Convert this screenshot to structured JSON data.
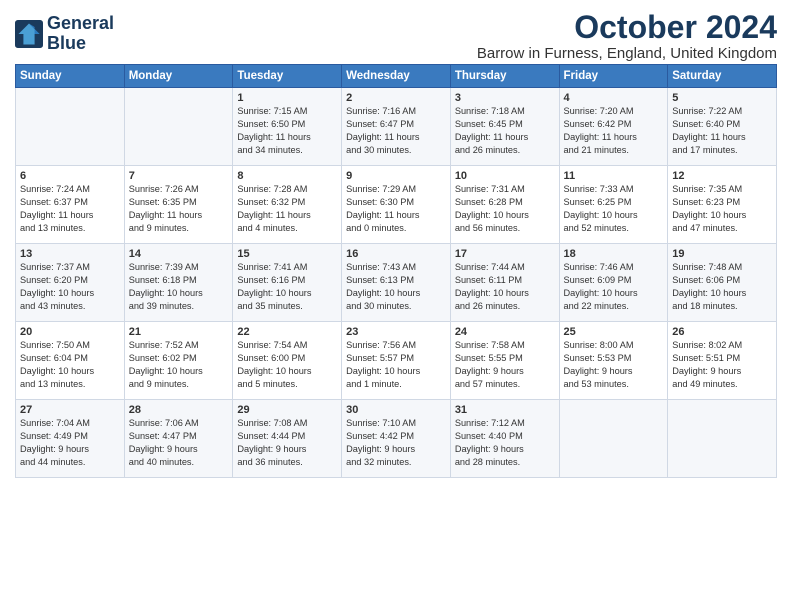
{
  "header": {
    "logo_line1": "General",
    "logo_line2": "Blue",
    "title": "October 2024",
    "location": "Barrow in Furness, England, United Kingdom"
  },
  "days_of_week": [
    "Sunday",
    "Monday",
    "Tuesday",
    "Wednesday",
    "Thursday",
    "Friday",
    "Saturday"
  ],
  "weeks": [
    [
      {
        "day": "",
        "info": ""
      },
      {
        "day": "",
        "info": ""
      },
      {
        "day": "1",
        "info": "Sunrise: 7:15 AM\nSunset: 6:50 PM\nDaylight: 11 hours\nand 34 minutes."
      },
      {
        "day": "2",
        "info": "Sunrise: 7:16 AM\nSunset: 6:47 PM\nDaylight: 11 hours\nand 30 minutes."
      },
      {
        "day": "3",
        "info": "Sunrise: 7:18 AM\nSunset: 6:45 PM\nDaylight: 11 hours\nand 26 minutes."
      },
      {
        "day": "4",
        "info": "Sunrise: 7:20 AM\nSunset: 6:42 PM\nDaylight: 11 hours\nand 21 minutes."
      },
      {
        "day": "5",
        "info": "Sunrise: 7:22 AM\nSunset: 6:40 PM\nDaylight: 11 hours\nand 17 minutes."
      }
    ],
    [
      {
        "day": "6",
        "info": "Sunrise: 7:24 AM\nSunset: 6:37 PM\nDaylight: 11 hours\nand 13 minutes."
      },
      {
        "day": "7",
        "info": "Sunrise: 7:26 AM\nSunset: 6:35 PM\nDaylight: 11 hours\nand 9 minutes."
      },
      {
        "day": "8",
        "info": "Sunrise: 7:28 AM\nSunset: 6:32 PM\nDaylight: 11 hours\nand 4 minutes."
      },
      {
        "day": "9",
        "info": "Sunrise: 7:29 AM\nSunset: 6:30 PM\nDaylight: 11 hours\nand 0 minutes."
      },
      {
        "day": "10",
        "info": "Sunrise: 7:31 AM\nSunset: 6:28 PM\nDaylight: 10 hours\nand 56 minutes."
      },
      {
        "day": "11",
        "info": "Sunrise: 7:33 AM\nSunset: 6:25 PM\nDaylight: 10 hours\nand 52 minutes."
      },
      {
        "day": "12",
        "info": "Sunrise: 7:35 AM\nSunset: 6:23 PM\nDaylight: 10 hours\nand 47 minutes."
      }
    ],
    [
      {
        "day": "13",
        "info": "Sunrise: 7:37 AM\nSunset: 6:20 PM\nDaylight: 10 hours\nand 43 minutes."
      },
      {
        "day": "14",
        "info": "Sunrise: 7:39 AM\nSunset: 6:18 PM\nDaylight: 10 hours\nand 39 minutes."
      },
      {
        "day": "15",
        "info": "Sunrise: 7:41 AM\nSunset: 6:16 PM\nDaylight: 10 hours\nand 35 minutes."
      },
      {
        "day": "16",
        "info": "Sunrise: 7:43 AM\nSunset: 6:13 PM\nDaylight: 10 hours\nand 30 minutes."
      },
      {
        "day": "17",
        "info": "Sunrise: 7:44 AM\nSunset: 6:11 PM\nDaylight: 10 hours\nand 26 minutes."
      },
      {
        "day": "18",
        "info": "Sunrise: 7:46 AM\nSunset: 6:09 PM\nDaylight: 10 hours\nand 22 minutes."
      },
      {
        "day": "19",
        "info": "Sunrise: 7:48 AM\nSunset: 6:06 PM\nDaylight: 10 hours\nand 18 minutes."
      }
    ],
    [
      {
        "day": "20",
        "info": "Sunrise: 7:50 AM\nSunset: 6:04 PM\nDaylight: 10 hours\nand 13 minutes."
      },
      {
        "day": "21",
        "info": "Sunrise: 7:52 AM\nSunset: 6:02 PM\nDaylight: 10 hours\nand 9 minutes."
      },
      {
        "day": "22",
        "info": "Sunrise: 7:54 AM\nSunset: 6:00 PM\nDaylight: 10 hours\nand 5 minutes."
      },
      {
        "day": "23",
        "info": "Sunrise: 7:56 AM\nSunset: 5:57 PM\nDaylight: 10 hours\nand 1 minute."
      },
      {
        "day": "24",
        "info": "Sunrise: 7:58 AM\nSunset: 5:55 PM\nDaylight: 9 hours\nand 57 minutes."
      },
      {
        "day": "25",
        "info": "Sunrise: 8:00 AM\nSunset: 5:53 PM\nDaylight: 9 hours\nand 53 minutes."
      },
      {
        "day": "26",
        "info": "Sunrise: 8:02 AM\nSunset: 5:51 PM\nDaylight: 9 hours\nand 49 minutes."
      }
    ],
    [
      {
        "day": "27",
        "info": "Sunrise: 7:04 AM\nSunset: 4:49 PM\nDaylight: 9 hours\nand 44 minutes."
      },
      {
        "day": "28",
        "info": "Sunrise: 7:06 AM\nSunset: 4:47 PM\nDaylight: 9 hours\nand 40 minutes."
      },
      {
        "day": "29",
        "info": "Sunrise: 7:08 AM\nSunset: 4:44 PM\nDaylight: 9 hours\nand 36 minutes."
      },
      {
        "day": "30",
        "info": "Sunrise: 7:10 AM\nSunset: 4:42 PM\nDaylight: 9 hours\nand 32 minutes."
      },
      {
        "day": "31",
        "info": "Sunrise: 7:12 AM\nSunset: 4:40 PM\nDaylight: 9 hours\nand 28 minutes."
      },
      {
        "day": "",
        "info": ""
      },
      {
        "day": "",
        "info": ""
      }
    ]
  ]
}
